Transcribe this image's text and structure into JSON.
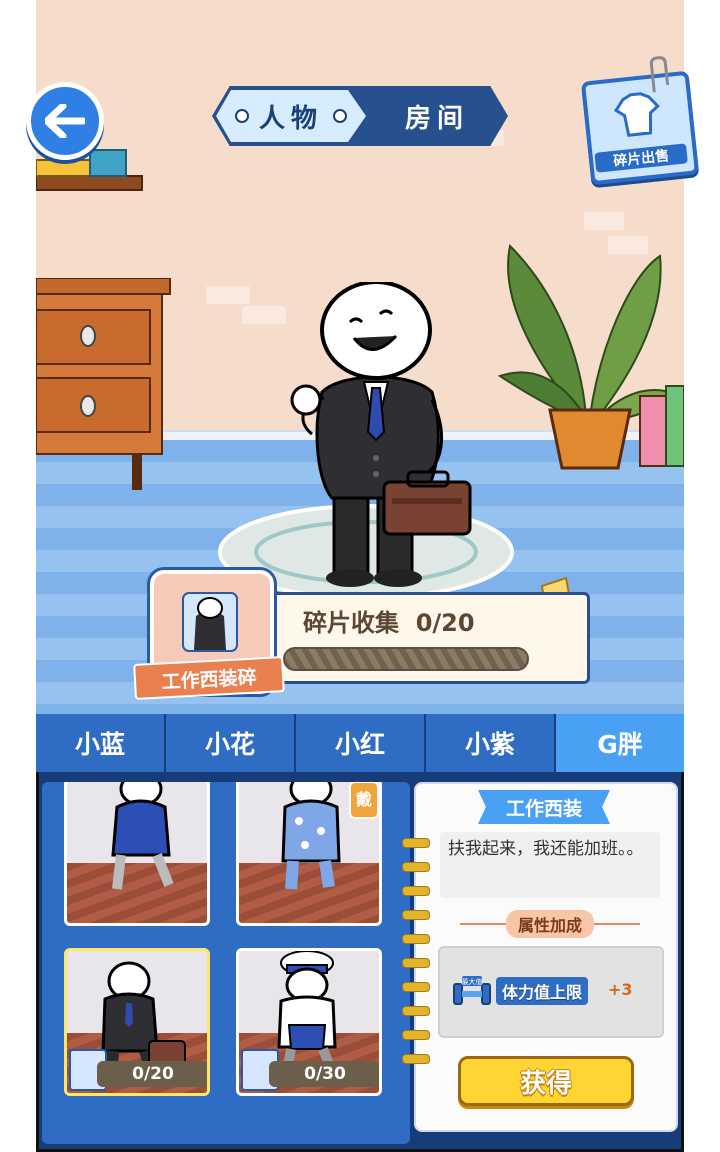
{
  "header": {
    "back_icon": "arrow-left-icon",
    "segment_left": "人物",
    "segment_right": "房间",
    "fragment_sell_label": "碎片出售"
  },
  "collection": {
    "label": "碎片收集",
    "progress_text": "0/20",
    "progress_fraction": 0,
    "fragment_name": "工作西装碎"
  },
  "tabs": [
    {
      "label": "小蓝",
      "active": false
    },
    {
      "label": "小花",
      "active": false
    },
    {
      "label": "小红",
      "active": false
    },
    {
      "label": "小紫",
      "active": false
    },
    {
      "label": "G胖",
      "active": true
    }
  ],
  "outfits": [
    {
      "name": "blue-hoodie",
      "count": ""
    },
    {
      "name": "polka-pajamas",
      "count": "",
      "badge": "戴"
    },
    {
      "name": "work-suit",
      "count": "0/20",
      "selected": true
    },
    {
      "name": "chef-outfit",
      "count": "0/30"
    }
  ],
  "detail": {
    "title": "工作西装",
    "description": "扶我起来，我还能加班。。",
    "attr_header": "属性加成",
    "attr_icon_badge": "最大值",
    "attr_name": "体力值上限",
    "attr_value": "+3",
    "get_button": "获得"
  },
  "colors": {
    "primary_blue": "#2f6dc5",
    "active_tab": "#4aa1f4",
    "button_yellow": "#ffd533",
    "attr_orange": "#d36a1e"
  }
}
